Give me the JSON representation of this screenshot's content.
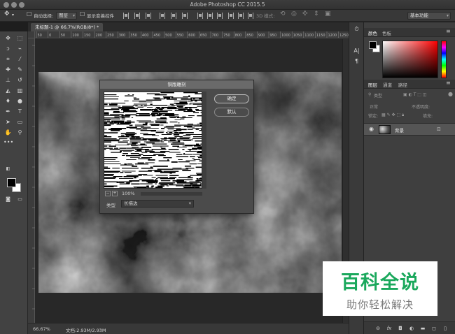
{
  "app": {
    "title": "Adobe Photoshop CC 2015.5"
  },
  "options_bar": {
    "auto_select_label": "自动选择:",
    "auto_select_value": "图层",
    "show_transform_label": "显示变换控件",
    "mode_3d_label": "3D 模式:",
    "workspace": "基本功能"
  },
  "document": {
    "tab_label": "未标题-1 @ 66.7%(RGB/8*) *"
  },
  "ruler": {
    "marks": [
      "50",
      "0",
      "50",
      "100",
      "150",
      "200",
      "250",
      "300",
      "350",
      "400",
      "450",
      "500",
      "550",
      "600",
      "650",
      "700",
      "750",
      "800",
      "850",
      "900",
      "950",
      "1000",
      "1050",
      "1100",
      "1150",
      "1200",
      "1250"
    ]
  },
  "status": {
    "zoom": "66.67%",
    "doc_info": "文档:2.93M/2.93M"
  },
  "color_panel": {
    "tabs": [
      "颜色",
      "色板"
    ]
  },
  "layers_panel": {
    "tabs": [
      "图层",
      "通道",
      "路径"
    ],
    "filter_label": "类型",
    "blend_mode": "正常",
    "opacity_label": "不透明度:",
    "lock_label": "锁定:",
    "fill_label": "填充:",
    "layer_name": "背景"
  },
  "dialog": {
    "title": "铜版雕刻",
    "ok": "确定",
    "reset": "默认",
    "zoom": "100%",
    "type_label": "类型",
    "type_value": "长描边"
  },
  "watermark": {
    "title": "百科全说",
    "subtitle": "助你轻松解决"
  }
}
